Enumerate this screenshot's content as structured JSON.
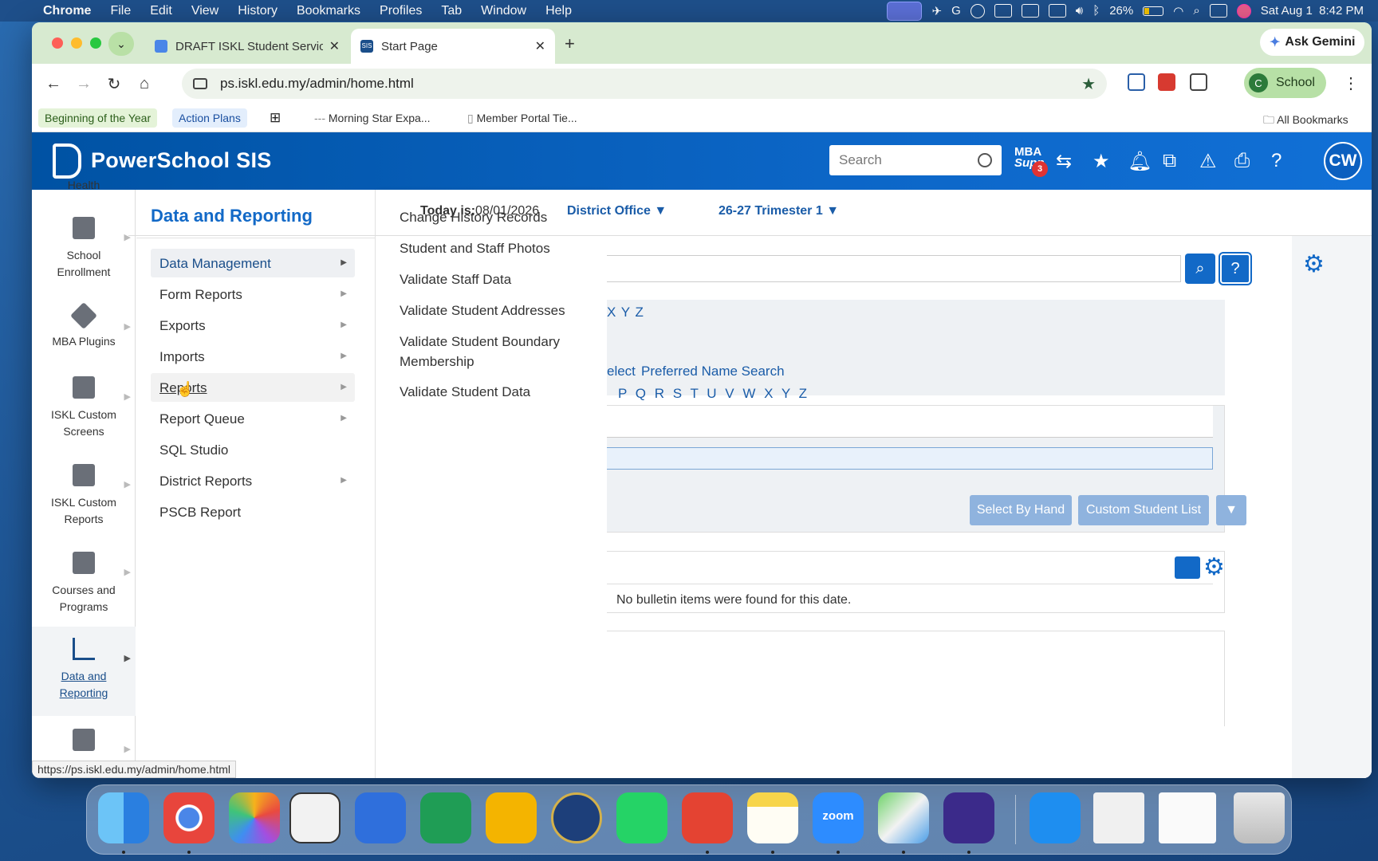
{
  "menubar": {
    "app_name": "Chrome",
    "items": [
      "File",
      "Edit",
      "View",
      "History",
      "Bookmarks",
      "Profiles",
      "Tab",
      "Window",
      "Help"
    ],
    "battery": "26%",
    "clock": "Sat Aug 1  8:42 PM"
  },
  "browser": {
    "tabs": [
      {
        "title": "DRAFT ISKL Student Services"
      },
      {
        "title": "Start Page"
      }
    ],
    "favicon_sis": "SIS",
    "ask_gemini": "Ask Gemini",
    "url": "ps.iskl.edu.my/admin/home.html",
    "profile_initial": "C",
    "profile_name": "School",
    "bookmarks": [
      "Beginning of the Year",
      "Action Plans",
      "Morning Star Expa...",
      "Member Portal Tie...",
      "All Bookmarks"
    ]
  },
  "powerschool": {
    "brand": "PowerSchool SIS",
    "search_placeholder": "Search",
    "mba_line1": "MBA",
    "mba_line2": "Supp",
    "mba_badge": "3",
    "user_initials": "CW",
    "left_nav": [
      {
        "label": "Health",
        "icon": "heart-icon"
      },
      {
        "label": "School Enrollment",
        "icon": "school-building-icon"
      },
      {
        "label": "MBA Plugins",
        "icon": "cube-icon"
      },
      {
        "label": "ISKL Custom Screens",
        "icon": "building-gear-icon"
      },
      {
        "label": "ISKL Custom Reports",
        "icon": "building-gear-icon"
      },
      {
        "label": "Courses and Programs",
        "icon": "desk-icon"
      },
      {
        "label": "Data and Reporting",
        "icon": "chart-icon"
      }
    ],
    "flyout": {
      "title": "Data and Reporting",
      "items": [
        "Data Management",
        "Form Reports",
        "Exports",
        "Imports",
        "Reports",
        "Report Queue",
        "SQL Studio",
        "District Reports",
        "PSCB Report"
      ]
    },
    "submenu": {
      "items": [
        "Change History Records",
        "Student and Staff Photos",
        "Validate Staff Data",
        "Validate Student Addresses",
        "Validate Student Boundary Membership",
        "Validate Student Data"
      ]
    },
    "content": {
      "today_label": "Today is:",
      "today_value": "08/01/2026",
      "school": "District Office",
      "term": "26-27 Trimester 1",
      "letters_row1": "X  Y  Z",
      "select_link": "elect",
      "preferred_name": "Preferred Name Search",
      "letters_row2": "P  Q  R  S  T  U  V  W  X  Y  Z",
      "select_by_hand": "Select By Hand",
      "custom_student_list": "Custom Student List",
      "no_bulletin": "No bulletin items were found for this date."
    },
    "status_url": "https://ps.iskl.edu.my/admin/home.html"
  },
  "dock": {
    "zoom_label": "zoom"
  },
  "colors": {
    "ps_blue": "#0c66c7",
    "link_blue": "#1a5ca8",
    "tab_bar": "#d7ead0"
  }
}
